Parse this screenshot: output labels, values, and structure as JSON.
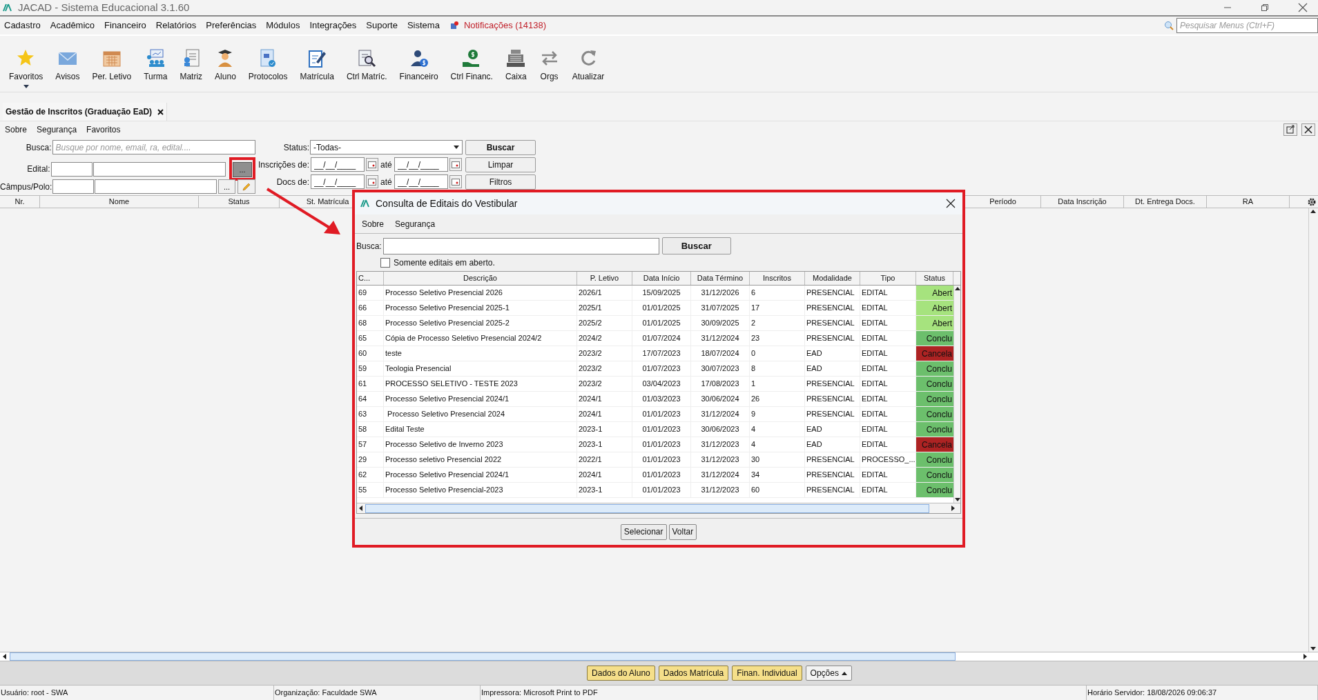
{
  "window": {
    "title": "JACAD - Sistema Educacional 3.1.60"
  },
  "menu": [
    "Cadastro",
    "Acadêmico",
    "Financeiro",
    "Relatórios",
    "Preferências",
    "Módulos",
    "Integrações",
    "Suporte",
    "Sistema"
  ],
  "notifications": "Notificações (14138)",
  "menu_search": {
    "placeholder": "Pesquisar Menus (Ctrl+F)"
  },
  "toolbar": [
    {
      "label": "Favoritos"
    },
    {
      "label": "Avisos"
    },
    {
      "label": "Per. Letivo"
    },
    {
      "label": "Turma"
    },
    {
      "label": "Matriz"
    },
    {
      "label": "Aluno"
    },
    {
      "label": "Protocolos"
    },
    {
      "label": "Matrícula"
    },
    {
      "label": "Ctrl Matríc."
    },
    {
      "label": "Financeiro"
    },
    {
      "label": "Ctrl Financ."
    },
    {
      "label": "Caixa"
    },
    {
      "label": "Orgs"
    },
    {
      "label": "Atualizar"
    }
  ],
  "tabs": [
    {
      "label": "Gestão de Inscritos (Graduação EaD)",
      "selected": true
    }
  ],
  "submenu": [
    "Sobre",
    "Segurança",
    "Favoritos"
  ],
  "filters": {
    "busca_label": "Busca:",
    "busca_placeholder": "Busque por nome, email, ra, edital....",
    "edital_label": "Edital:",
    "campus_label": "Câmpus/Polo:",
    "lookup_button": "...",
    "status_label": "Status:",
    "status_value": "-Todas-",
    "inscricoes_label": "Inscrições de:",
    "docs_label": "Docs de:",
    "to_labels": [
      "até",
      "até"
    ],
    "date_values": [
      "__/__/____",
      "__/__/____",
      "__/__/____",
      "__/__/____"
    ],
    "buttons": [
      "Buscar",
      "Limpar",
      "Filtros"
    ]
  },
  "table": {
    "columns": [
      "Nr.",
      "Nome",
      "Status",
      "St. Matrícula"
    ],
    "right_columns": [
      "Período",
      "Data Inscrição",
      "Dt. Entrega Docs.",
      "RA"
    ]
  },
  "dialog": {
    "title": "Consulta de Editais do Vestibular",
    "menu": [
      "Sobre",
      "Segurança"
    ],
    "search_label": "Busca:",
    "search_button": "Buscar",
    "only_open": {
      "label": "Somente editais em aberto.",
      "checked": false
    },
    "columns": [
      "C...",
      "Descrição",
      "P. Letivo",
      "Data Início",
      "Data Término",
      "Inscritos",
      "Modalidade",
      "Tipo",
      "Status"
    ],
    "rows": [
      {
        "cells": [
          "69",
          "Processo Seletivo Presencial 2026",
          "2026/1",
          "15/09/2025",
          "31/12/2026",
          "6",
          "PRESENCIAL",
          "EDITAL"
        ],
        "status": "Abert",
        "color": "#a6e37e"
      },
      {
        "cells": [
          "66",
          "Processo Seletivo Presencial 2025-1",
          "2025/1",
          "01/01/2025",
          "31/07/2025",
          "17",
          "PRESENCIAL",
          "EDITAL"
        ],
        "status": "Abert",
        "color": "#a6e37e"
      },
      {
        "cells": [
          "68",
          "Processo Seletivo Presencial 2025-2",
          "2025/2",
          "01/01/2025",
          "30/09/2025",
          "2",
          "PRESENCIAL",
          "EDITAL"
        ],
        "status": "Abert",
        "color": "#a6e37e"
      },
      {
        "cells": [
          "65",
          "Cópia de Processo Seletivo Presencial 2024/2",
          "2024/2",
          "01/07/2024",
          "31/12/2024",
          "23",
          "PRESENCIAL",
          "EDITAL"
        ],
        "status": "Conclu",
        "color": "#6cbf6c"
      },
      {
        "cells": [
          "60",
          "teste",
          "2023/2",
          "17/07/2023",
          "18/07/2024",
          "0",
          "EAD",
          "EDITAL"
        ],
        "status": "Cancela",
        "color": "#ad2323"
      },
      {
        "cells": [
          "59",
          "Teologia Presencial",
          "2023/2",
          "01/07/2023",
          "30/07/2023",
          "8",
          "EAD",
          "EDITAL"
        ],
        "status": "Conclu",
        "color": "#6cbf6c"
      },
      {
        "cells": [
          "61",
          "PROCESSO SELETIVO - TESTE 2023",
          "2023/2",
          "03/04/2023",
          "17/08/2023",
          "1",
          "PRESENCIAL",
          "EDITAL"
        ],
        "status": "Conclu",
        "color": "#6cbf6c"
      },
      {
        "cells": [
          "64",
          "Processo Seletivo Presencial 2024/1",
          "2024/1",
          "01/03/2023",
          "30/06/2024",
          "26",
          "PRESENCIAL",
          "EDITAL"
        ],
        "status": "Conclu",
        "color": "#6cbf6c"
      },
      {
        "cells": [
          "63",
          " Processo Seletivo Presencial 2024",
          "2024/1",
          "01/01/2023",
          "31/12/2024",
          "9",
          "PRESENCIAL",
          "EDITAL"
        ],
        "status": "Conclu",
        "color": "#6cbf6c"
      },
      {
        "cells": [
          "58",
          "Edital Teste",
          "2023-1",
          "01/01/2023",
          "30/06/2023",
          "4",
          "EAD",
          "EDITAL"
        ],
        "status": "Conclu",
        "color": "#6cbf6c"
      },
      {
        "cells": [
          "57",
          "Processo Seletivo de Inverno 2023",
          "2023-1",
          "01/01/2023",
          "31/12/2023",
          "4",
          "EAD",
          "EDITAL"
        ],
        "status": "Cancela",
        "color": "#ad2323"
      },
      {
        "cells": [
          "29",
          "Processo seletivo Presencial 2022",
          "2022/1",
          "01/01/2023",
          "31/12/2023",
          "30",
          "PRESENCIAL",
          "PROCESSO_..."
        ],
        "status": "Conclu",
        "color": "#6cbf6c"
      },
      {
        "cells": [
          "62",
          "Processo Seletivo Presencial 2024/1",
          "2024/1",
          "01/01/2023",
          "31/12/2024",
          "34",
          "PRESENCIAL",
          "EDITAL"
        ],
        "status": "Conclu",
        "color": "#6cbf6c"
      },
      {
        "cells": [
          "55",
          "Processo Seletivo Presencial-2023",
          "2023-1",
          "01/01/2023",
          "31/12/2023",
          "60",
          "PRESENCIAL",
          "EDITAL"
        ],
        "status": "Conclu",
        "color": "#6cbf6c"
      }
    ],
    "buttons": [
      "Selecionar",
      "Voltar"
    ]
  },
  "actions": [
    "Dados do Aluno",
    "Dados Matrícula",
    "Finan. Individual"
  ],
  "options_button": "Opções",
  "status_bar": [
    "Usuário: root - SWA",
    "Organização: Faculdade SWA",
    "Impressora: Microsoft Print to PDF",
    "Horário Servidor: 18/08/2026 09:06:37"
  ]
}
